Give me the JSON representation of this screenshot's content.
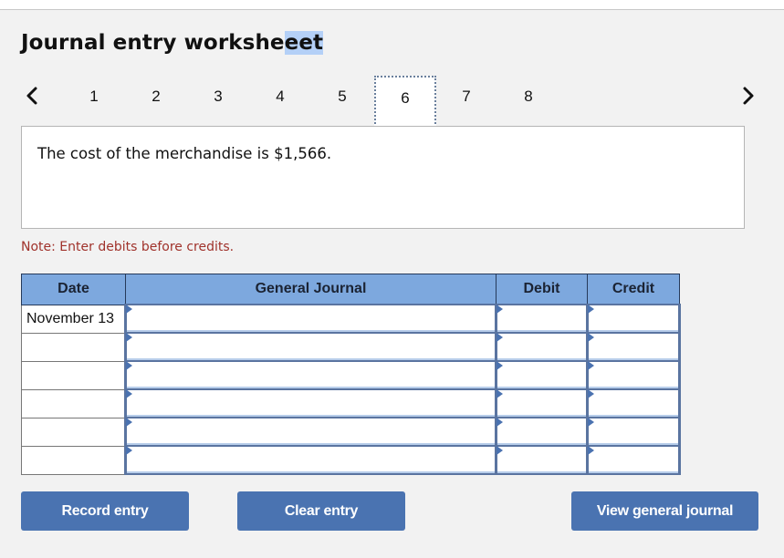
{
  "title": {
    "text_main": "Journal entry workshe",
    "text_selected": "eet"
  },
  "pager": {
    "prev_icon": "chevron-left-icon",
    "next_icon": "chevron-right-icon",
    "pages": [
      "1",
      "2",
      "3",
      "4",
      "5",
      "6",
      "7",
      "8"
    ],
    "active_page": "6"
  },
  "content": {
    "text": "The cost of the merchandise is $1,566."
  },
  "note": "Note: Enter debits before credits.",
  "table": {
    "headers": {
      "date": "Date",
      "general_journal": "General Journal",
      "debit": "Debit",
      "credit": "Credit"
    },
    "rows": [
      {
        "date": "November 13",
        "account": "",
        "debit": "",
        "credit": ""
      },
      {
        "date": "",
        "account": "",
        "debit": "",
        "credit": ""
      },
      {
        "date": "",
        "account": "",
        "debit": "",
        "credit": ""
      },
      {
        "date": "",
        "account": "",
        "debit": "",
        "credit": ""
      },
      {
        "date": "",
        "account": "",
        "debit": "",
        "credit": ""
      },
      {
        "date": "",
        "account": "",
        "debit": "",
        "credit": ""
      }
    ]
  },
  "buttons": {
    "record": "Record entry",
    "clear": "Clear entry",
    "view": "View general journal"
  },
  "colors": {
    "accent": "#4a73b1",
    "header_bg": "#7da8de",
    "note": "#a0322b",
    "background": "#f2f2f2"
  }
}
